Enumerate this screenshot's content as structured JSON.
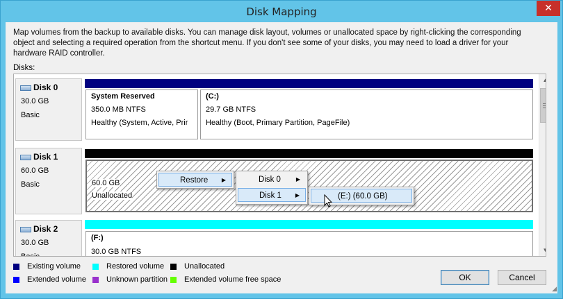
{
  "window": {
    "title": "Disk Mapping",
    "close_glyph": "✕"
  },
  "description": "Map volumes from the backup to available disks. You can manage disk layout, volumes or unallocated space by right-clicking the corresponding object and selecting a required operation from the shortcut menu. If you don't see some of your disks, you may need to load a driver for your hardware RAID controller.",
  "disks_label": "Disks:",
  "disks": [
    {
      "name": "Disk 0",
      "size": "30.0 GB",
      "type": "Basic",
      "bar_color": "#000080",
      "volumes": [
        {
          "name": "System Reserved",
          "line1": "350.0 MB NTFS",
          "line2": "Healthy (System, Active, Prir"
        },
        {
          "name": "(C:)",
          "line1": "29.7 GB NTFS",
          "line2": "Healthy (Boot, Primary Partition, PageFile)"
        }
      ]
    },
    {
      "name": "Disk 1",
      "size": "60.0 GB",
      "type": "Basic",
      "bar_color": "#000000",
      "volumes": [
        {
          "name": "",
          "line1": "60.0 GB",
          "line2": "Unallocated"
        }
      ]
    },
    {
      "name": "Disk 2",
      "size": "30.0 GB",
      "type": "Basic",
      "bar_color": "#00ffff",
      "volumes": [
        {
          "name": "(F:)",
          "line1": "30.0 GB NTFS",
          "line2": ""
        }
      ]
    }
  ],
  "context_menu": {
    "restore": "Restore",
    "disks": [
      "Disk 0",
      "Disk 1"
    ],
    "target": "(E:) (60.0 GB)"
  },
  "legend": [
    {
      "label": "Existing volume",
      "color": "#000080"
    },
    {
      "label": "Restored volume",
      "color": "#00ffff"
    },
    {
      "label": "Unallocated",
      "color": "#000000"
    },
    {
      "label": "Extended volume",
      "color": "#0000ff"
    },
    {
      "label": "Unknown partition",
      "color": "#9932cc"
    },
    {
      "label": "Extended volume free space",
      "color": "#66ff00"
    }
  ],
  "buttons": {
    "ok": "OK",
    "cancel": "Cancel"
  },
  "icons": {
    "scroll_up": "▲",
    "scroll_down": "▼",
    "submenu": "▶"
  }
}
